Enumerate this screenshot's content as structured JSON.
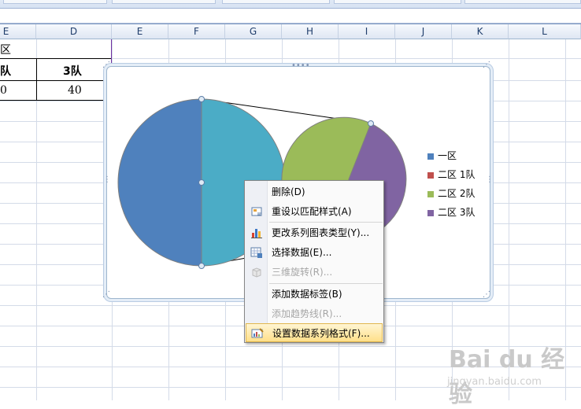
{
  "columns": [
    "E",
    "D",
    "E",
    "F",
    "G",
    "H",
    "I",
    "J",
    "K",
    "L"
  ],
  "sheet": {
    "region_label": "区",
    "team_left": "队",
    "team_right": "3队",
    "value_left": "0",
    "value_right": "40"
  },
  "chart": {
    "legend": [
      {
        "label": "一区",
        "color": "#4f81bd"
      },
      {
        "label": "二区 1队",
        "color": "#c0504d"
      },
      {
        "label": "二区 2队",
        "color": "#9bbb59"
      },
      {
        "label": "二区 3队",
        "color": "#8064a2"
      }
    ],
    "colors": {
      "big_left": "#4f81bd",
      "big_right": "#4bacc6",
      "small_green": "#9bbb59",
      "small_purple": "#8064a2"
    }
  },
  "context_menu": {
    "items": [
      {
        "label": "删除(D)",
        "state": "normal",
        "icon": ""
      },
      {
        "label": "重设以匹配样式(A)",
        "state": "normal",
        "icon": "reset-style-icon"
      },
      {
        "label": "更改系列图表类型(Y)...",
        "state": "normal",
        "icon": "chart-type-icon"
      },
      {
        "label": "选择数据(E)...",
        "state": "normal",
        "icon": "select-data-icon"
      },
      {
        "label": "三维旋转(R)...",
        "state": "disabled",
        "icon": "rotate-3d-icon"
      },
      {
        "label": "添加数据标签(B)",
        "state": "normal",
        "icon": ""
      },
      {
        "label": "添加趋势线(R)...",
        "state": "disabled",
        "icon": ""
      },
      {
        "label": "设置数据系列格式(F)...",
        "state": "active",
        "icon": "format-series-icon"
      }
    ]
  },
  "watermark": {
    "brand": "Bai du 经验",
    "url": "jingyan.baidu.com"
  }
}
